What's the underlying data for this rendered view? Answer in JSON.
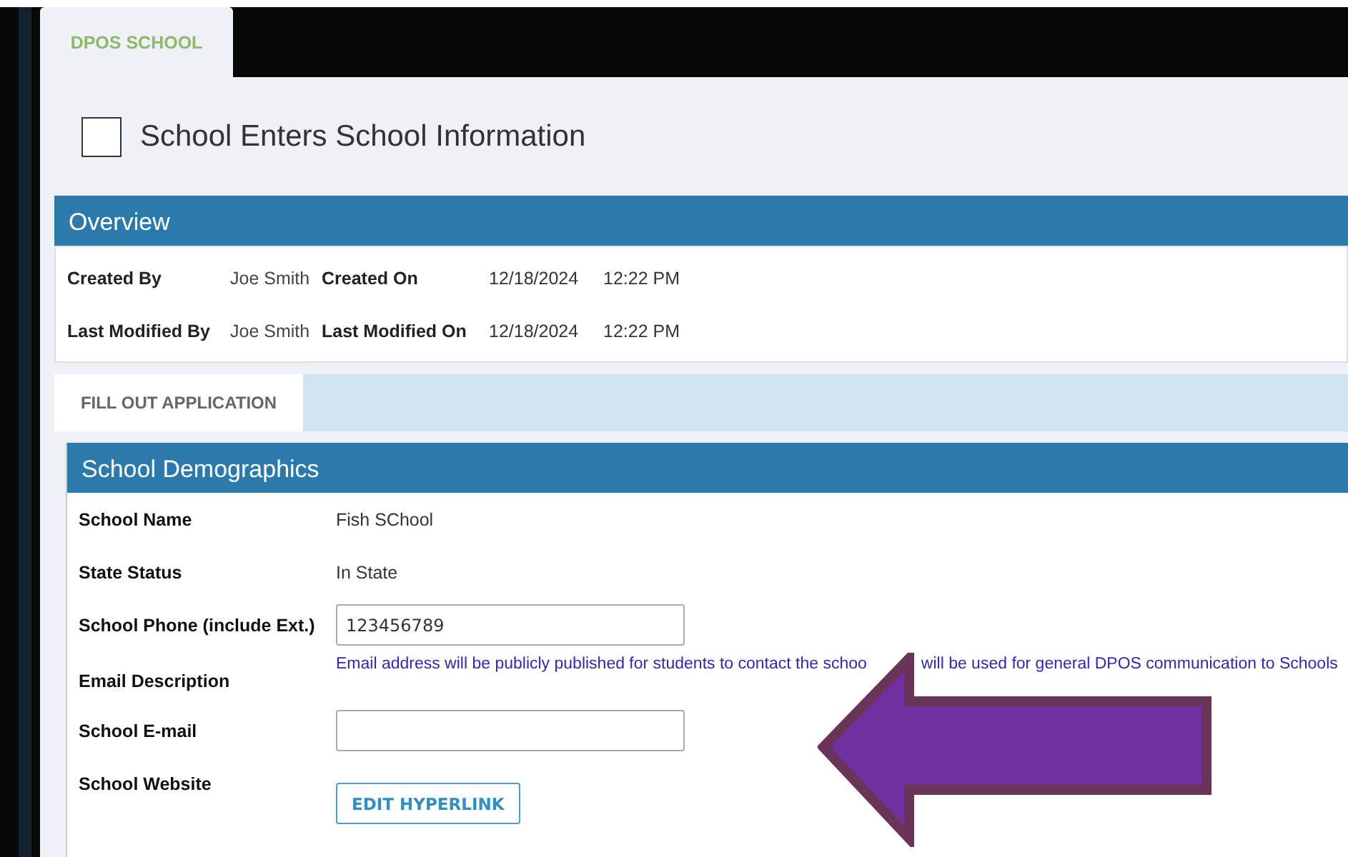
{
  "top_tab": {
    "label": "DPOS SCHOOL",
    "selected": true
  },
  "page_title": {
    "text": "School Enters School Information",
    "checked": false
  },
  "overview": {
    "title": "Overview",
    "rows": [
      {
        "label": "Created By",
        "value": "Joe Smith",
        "label_2": "Created On",
        "date": "12/18/2024",
        "time": "12:22 PM"
      },
      {
        "label": "Last Modified By",
        "value": "Joe Smith",
        "label_2": "Last Modified On",
        "date": "12/18/2024",
        "time": "12:22 PM"
      }
    ]
  },
  "tabs": [
    {
      "label": "FILL OUT APPLICATION",
      "selected": true
    }
  ],
  "section": {
    "title": "School Demographics",
    "fields": [
      {
        "kind": "text",
        "label": "School Name",
        "value": "Fish SChool"
      },
      {
        "kind": "text",
        "label": "State Status",
        "value": "In State"
      },
      {
        "kind": "input",
        "label": "School Phone (include Ext.)",
        "value": "123456789"
      },
      {
        "kind": "note",
        "label": "Email Description",
        "value": "Email address will be publicly published for students to contact the schoo",
        "value_2": "will be used for general DPOS communication to Schools"
      },
      {
        "kind": "input",
        "label": "School E-mail"
      },
      {
        "kind": "button",
        "label": "School Website",
        "value": "EDIT HYPERLINK"
      }
    ]
  }
}
